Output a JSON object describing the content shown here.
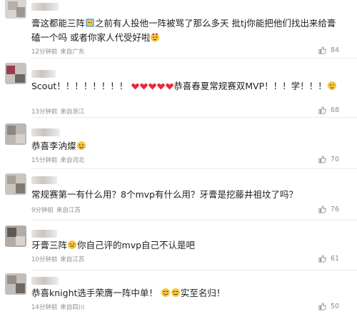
{
  "comments": [
    {
      "text_before": "膏这都能三阵",
      "text_after": "之前有人投他一阵被骂了那么多天 批tj你能把他们找出来给膏磕一个吗 或者你家人代受好啦",
      "time": "12分钟前",
      "location": "来自广东",
      "likes": "84"
    },
    {
      "text_before": "Scout！！！！！！！！",
      "text_after": "恭喜春夏常规赛双MVP！！！学！！！",
      "time": "13分钟前",
      "location": "来自浙江",
      "likes": "68"
    },
    {
      "text_before": "恭喜李汭燦",
      "text_after": "",
      "time": "15分钟前",
      "location": "来自河北",
      "likes": "70"
    },
    {
      "text_before": "常规赛第一有什么用？8个mvp有什么用？牙膏是挖藤井祖坟了吗？",
      "text_after": "",
      "time": "9分钟前",
      "location": "来自江苏",
      "likes": "76"
    },
    {
      "text_before": "牙膏三阵",
      "text_after": "你自己评的mvp自己不认是吧",
      "time": "10分钟前",
      "location": "来自江苏",
      "likes": "61"
    },
    {
      "text_before": "恭喜knight选手荣膺一阵中单！",
      "text_after": "实至名归！",
      "time": "14分钟前",
      "location": "来自四川",
      "likes": "50"
    }
  ],
  "colors": {
    "text": "#1e1e1e",
    "meta": "#8e8e8e",
    "heart": "#e8293f",
    "emoji_yellow": "#f7c63a"
  },
  "icons": {
    "like": "thumbs-up-icon",
    "heart": "red-heart-emoji",
    "face": "face-emoji"
  }
}
